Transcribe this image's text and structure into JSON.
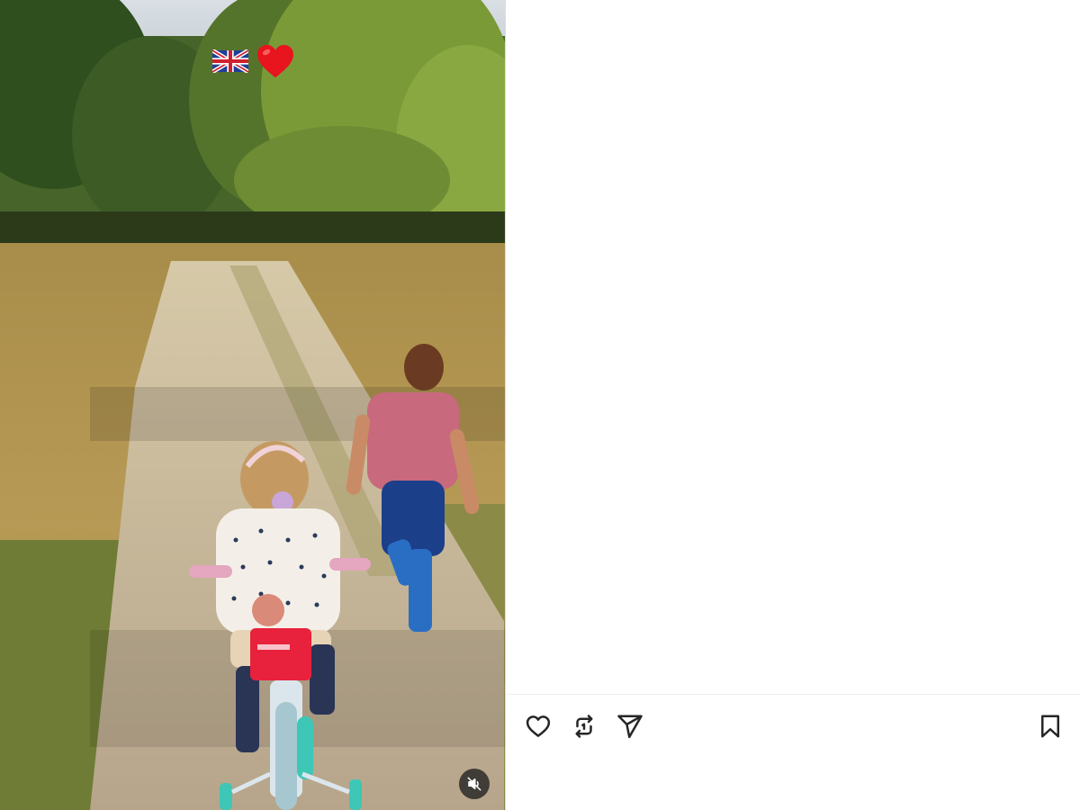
{
  "post": {
    "media": {
      "type": "video",
      "description_icons": [
        "union-jack-flag-icon",
        "red-heart-icon"
      ],
      "muted": true
    },
    "actions": {
      "like_icon": "heart-outline-icon",
      "repost_icon": "repost-icon",
      "share_icon": "paper-plane-icon",
      "save_icon": "bookmark-outline-icon"
    }
  },
  "colors": {
    "icon_stroke": "#262626",
    "divider": "#efefef",
    "heart_red": "#e8141e"
  }
}
